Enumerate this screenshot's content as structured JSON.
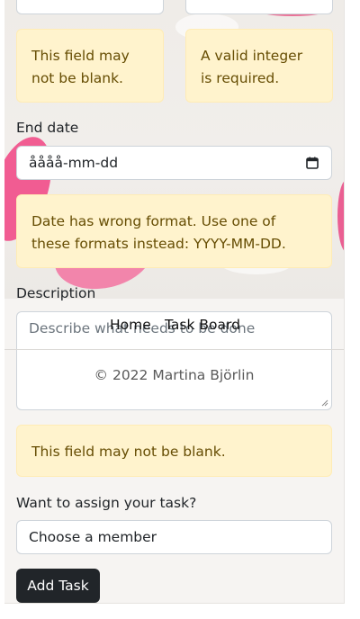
{
  "form": {
    "alerts": {
      "blank_left": "This field may not be blank.",
      "integer_right": "A valid integer is required.",
      "date_format": "Date has wrong format. Use one of these formats instead: YYYY-MM-DD.",
      "blank_description": "This field may not be blank."
    },
    "end_date": {
      "label": "End date",
      "value": "åååå-mm-dd",
      "icon": "calendar-icon"
    },
    "description": {
      "label": "Description",
      "placeholder": "Describe what needs to be done"
    },
    "assign": {
      "label": "Want to assign your task?",
      "selected": "Choose a member"
    },
    "submit_label": "Add Task"
  },
  "nav": {
    "home": "Home",
    "task_board": "Task Board"
  },
  "footer": {
    "copyright": "© 2022 Martina Björlin"
  },
  "colors": {
    "alert_bg": "#fff3cd",
    "alert_text": "#664d03",
    "button_bg": "#212529"
  }
}
